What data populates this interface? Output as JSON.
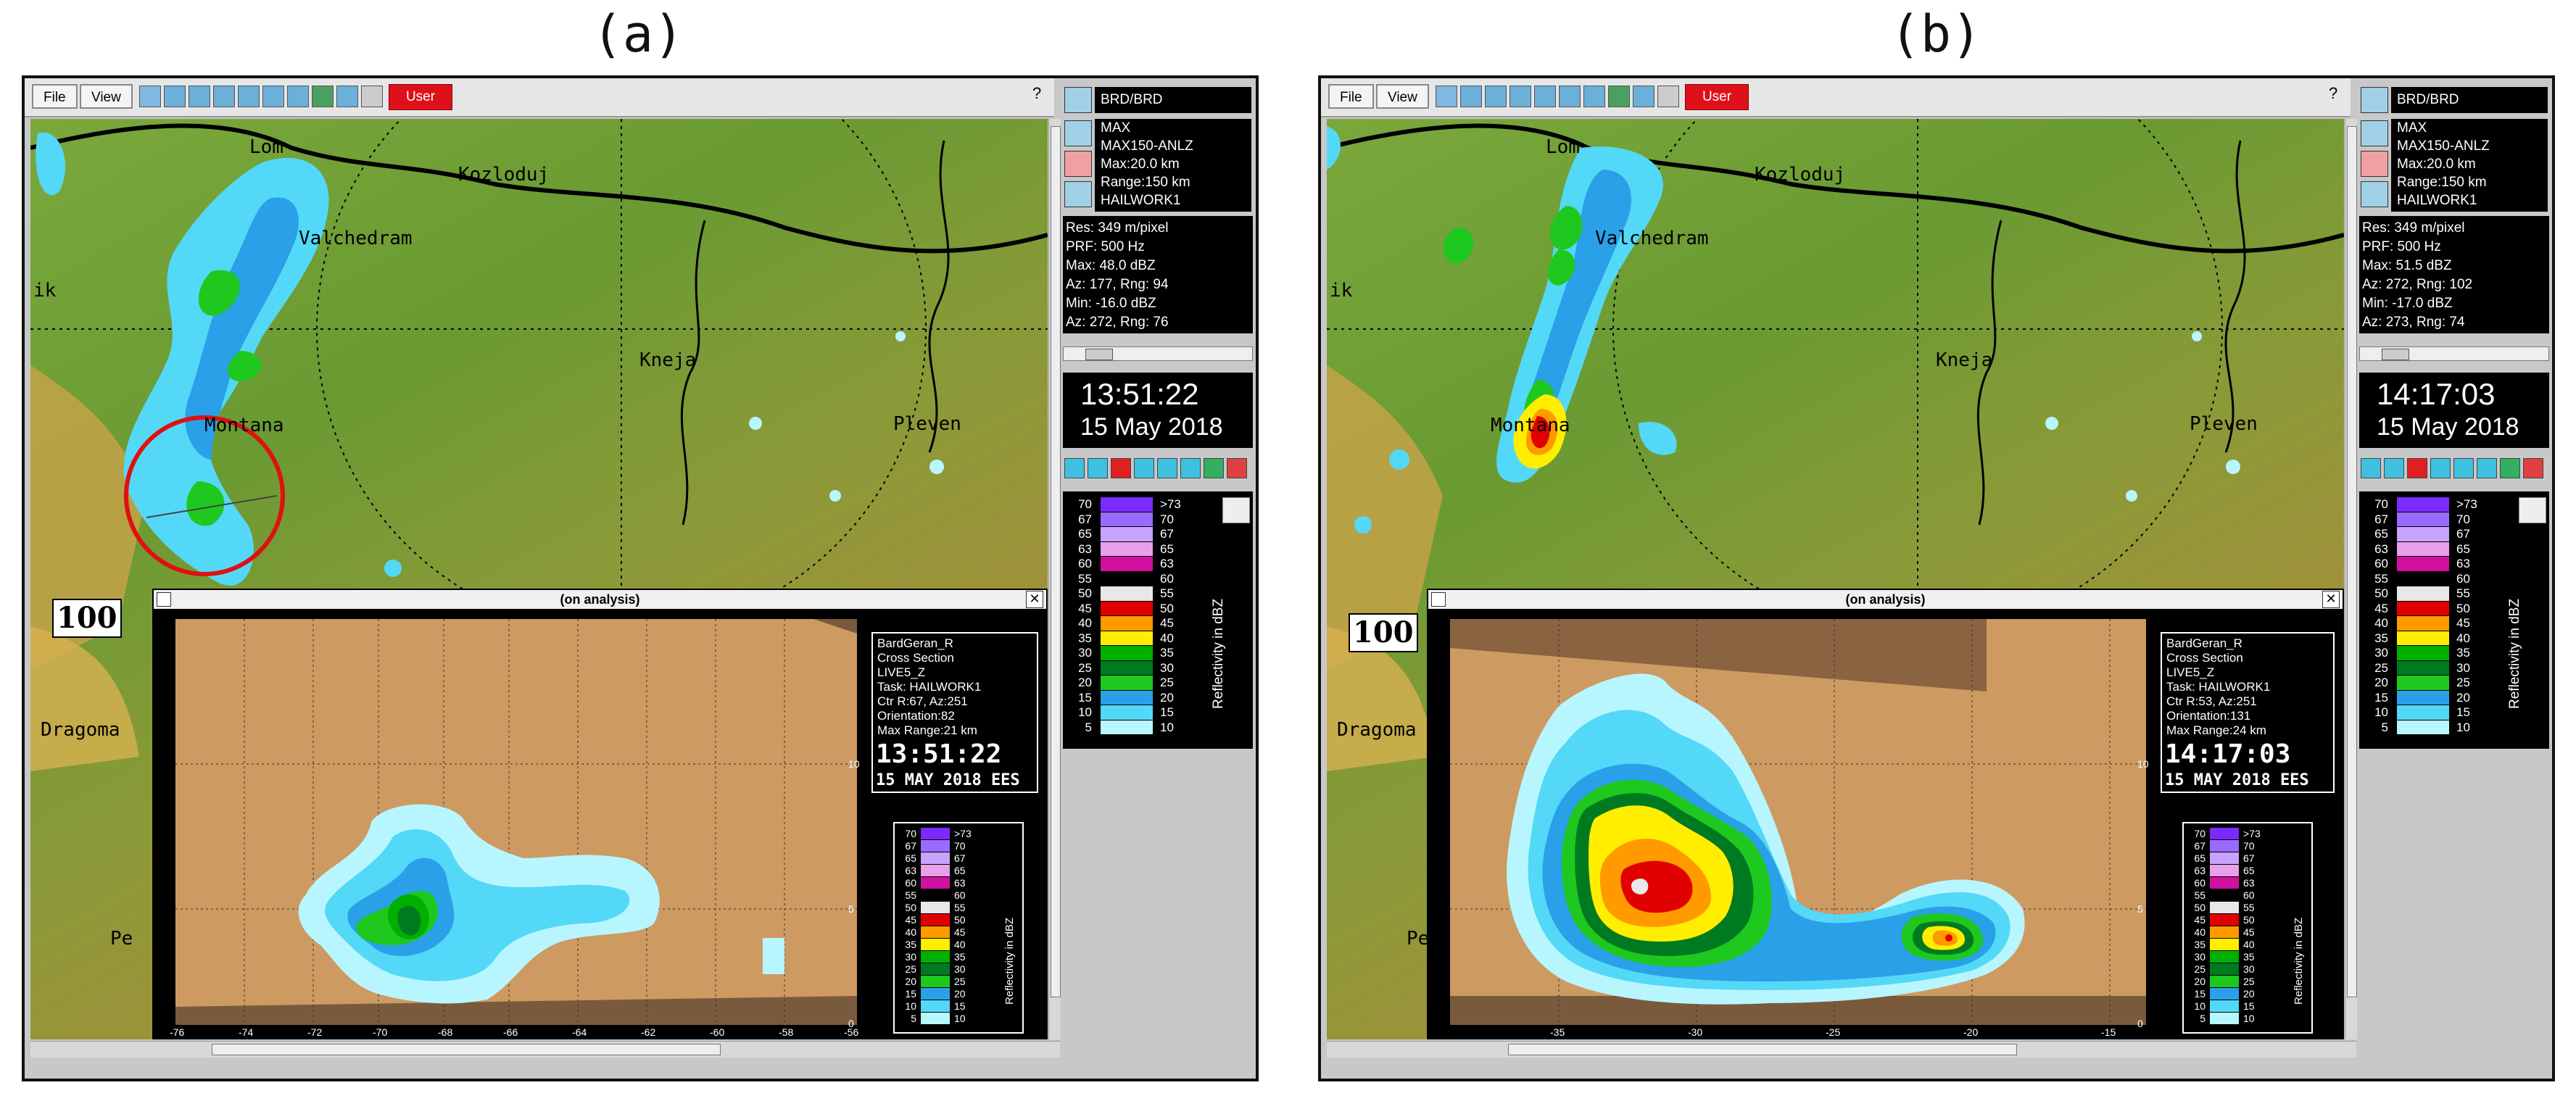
{
  "panels": [
    {
      "caption": "(a)",
      "menu": {
        "file": "File",
        "view": "View",
        "user": "User",
        "help": "?"
      },
      "side": {
        "site": "BRD/BRD",
        "product_lines": [
          "MAX",
          "MAX150-ANLZ",
          "Max:20.0 km",
          "Range:150 km",
          "HAILWORK1"
        ],
        "stats": [
          "Res: 349 m/pixel",
          "PRF: 500 Hz",
          "Max: 48.0 dBZ",
          "Az:  177, Rng: 94",
          "Min: -16.0 dBZ",
          "Az:  272, Rng: 76"
        ],
        "time": "13:51:22",
        "date": "15 May 2018"
      },
      "legend": {
        "title": "Reflectivity in dBZ",
        "rows": [
          {
            "l": "70",
            "r": ">73",
            "c": "#7b2bff"
          },
          {
            "l": "67",
            "r": "70",
            "c": "#9b6bff"
          },
          {
            "l": "65",
            "r": "67",
            "c": "#c5a3ff"
          },
          {
            "l": "63",
            "r": "65",
            "c": "#e8a0e8"
          },
          {
            "l": "60",
            "r": "63",
            "c": "#d010a0"
          },
          {
            "l": "55",
            "r": "60",
            "c": "#000000"
          },
          {
            "l": "50",
            "r": "55",
            "c": "#e8e8e8"
          },
          {
            "l": "45",
            "r": "50",
            "c": "#e00000"
          },
          {
            "l": "40",
            "r": "45",
            "c": "#ff9a00"
          },
          {
            "l": "35",
            "r": "40",
            "c": "#ffee00"
          },
          {
            "l": "30",
            "r": "35",
            "c": "#00b000"
          },
          {
            "l": "25",
            "r": "30",
            "c": "#007a20"
          },
          {
            "l": "20",
            "r": "25",
            "c": "#1ec81e"
          },
          {
            "l": "15",
            "r": "20",
            "c": "#2aa0e8"
          },
          {
            "l": "10",
            "r": "15",
            "c": "#54d8f8"
          },
          {
            "l": "5",
            "r": "10",
            "c": "#b8f6ff"
          }
        ]
      },
      "map_labels": {
        "lom": "Lom",
        "kozloduy": "Kozloduj",
        "valchedram": "Valchedram",
        "kneja": "Kneja",
        "montana": "Montana",
        "pleven": "Pleven",
        "vratsa_partial": "ik",
        "dragoman": "Dragoma",
        "pernik": "Pe",
        "scale": "100"
      },
      "popup": {
        "title": "(on analysis)",
        "info_lines": [
          "BardGeran_R",
          "Cross Section",
          "LIVE5_Z",
          "Task: HAILWORK1",
          "Ctr R:67, Az:251",
          "Orientation:82",
          "Max Range:21 km"
        ],
        "time": "13:51:22",
        "date": "15 MAY 2018 EES",
        "x_ticks": [
          "-76",
          "-74",
          "-72",
          "-70",
          "-68",
          "-66",
          "-64",
          "-62",
          "-60",
          "-58",
          "-56"
        ],
        "y_ticks": [
          "10",
          "5",
          "0"
        ],
        "legend_title": "Reflectivity in dBZ"
      }
    },
    {
      "caption": "(b)",
      "menu": {
        "file": "File",
        "view": "View",
        "user": "User",
        "help": "?"
      },
      "side": {
        "site": "BRD/BRD",
        "product_lines": [
          "MAX",
          "MAX150-ANLZ",
          "Max:20.0 km",
          "Range:150 km",
          "HAILWORK1"
        ],
        "stats": [
          "Res: 349 m/pixel",
          "PRF: 500 Hz",
          "Max: 51.5 dBZ",
          "Az:  272, Rng: 102",
          "Min: -17.0 dBZ",
          "Az:  273, Rng: 74"
        ],
        "time": "14:17:03",
        "date": "15 May 2018"
      },
      "legend": {
        "title": "Reflectivity in dBZ",
        "rows": [
          {
            "l": "70",
            "r": ">73",
            "c": "#7b2bff"
          },
          {
            "l": "67",
            "r": "70",
            "c": "#9b6bff"
          },
          {
            "l": "65",
            "r": "67",
            "c": "#c5a3ff"
          },
          {
            "l": "63",
            "r": "65",
            "c": "#e8a0e8"
          },
          {
            "l": "60",
            "r": "63",
            "c": "#d010a0"
          },
          {
            "l": "55",
            "r": "60",
            "c": "#000000"
          },
          {
            "l": "50",
            "r": "55",
            "c": "#e8e8e8"
          },
          {
            "l": "45",
            "r": "50",
            "c": "#e00000"
          },
          {
            "l": "40",
            "r": "45",
            "c": "#ff9a00"
          },
          {
            "l": "35",
            "r": "40",
            "c": "#ffee00"
          },
          {
            "l": "30",
            "r": "35",
            "c": "#00b000"
          },
          {
            "l": "25",
            "r": "30",
            "c": "#007a20"
          },
          {
            "l": "20",
            "r": "25",
            "c": "#1ec81e"
          },
          {
            "l": "15",
            "r": "20",
            "c": "#2aa0e8"
          },
          {
            "l": "10",
            "r": "15",
            "c": "#54d8f8"
          },
          {
            "l": "5",
            "r": "10",
            "c": "#b8f6ff"
          }
        ]
      },
      "map_labels": {
        "lom": "Lom",
        "kozloduy": "Kozloduj",
        "valchedram": "Valchedram",
        "kneja": "Kneja",
        "montana": "Montana",
        "pleven": "Pleven",
        "vratsa_partial": "ik",
        "dragoman": "Dragoma",
        "pernik": "Pe",
        "scale": "100"
      },
      "popup": {
        "title": "(on analysis)",
        "info_lines": [
          "BardGeran_R",
          "Cross Section",
          "LIVE5_Z",
          "Task: HAILWORK1",
          "Ctr R:53, Az:251",
          "Orientation:131",
          "Max Range:24 km"
        ],
        "time": "14:17:03",
        "date": "15 MAY 2018 EES",
        "x_ticks": [
          "-35",
          "-30",
          "-25",
          "-20",
          "-15"
        ],
        "y_ticks": [
          "10",
          "5",
          "0"
        ],
        "legend_title": "Reflectivity in dBZ"
      }
    }
  ]
}
